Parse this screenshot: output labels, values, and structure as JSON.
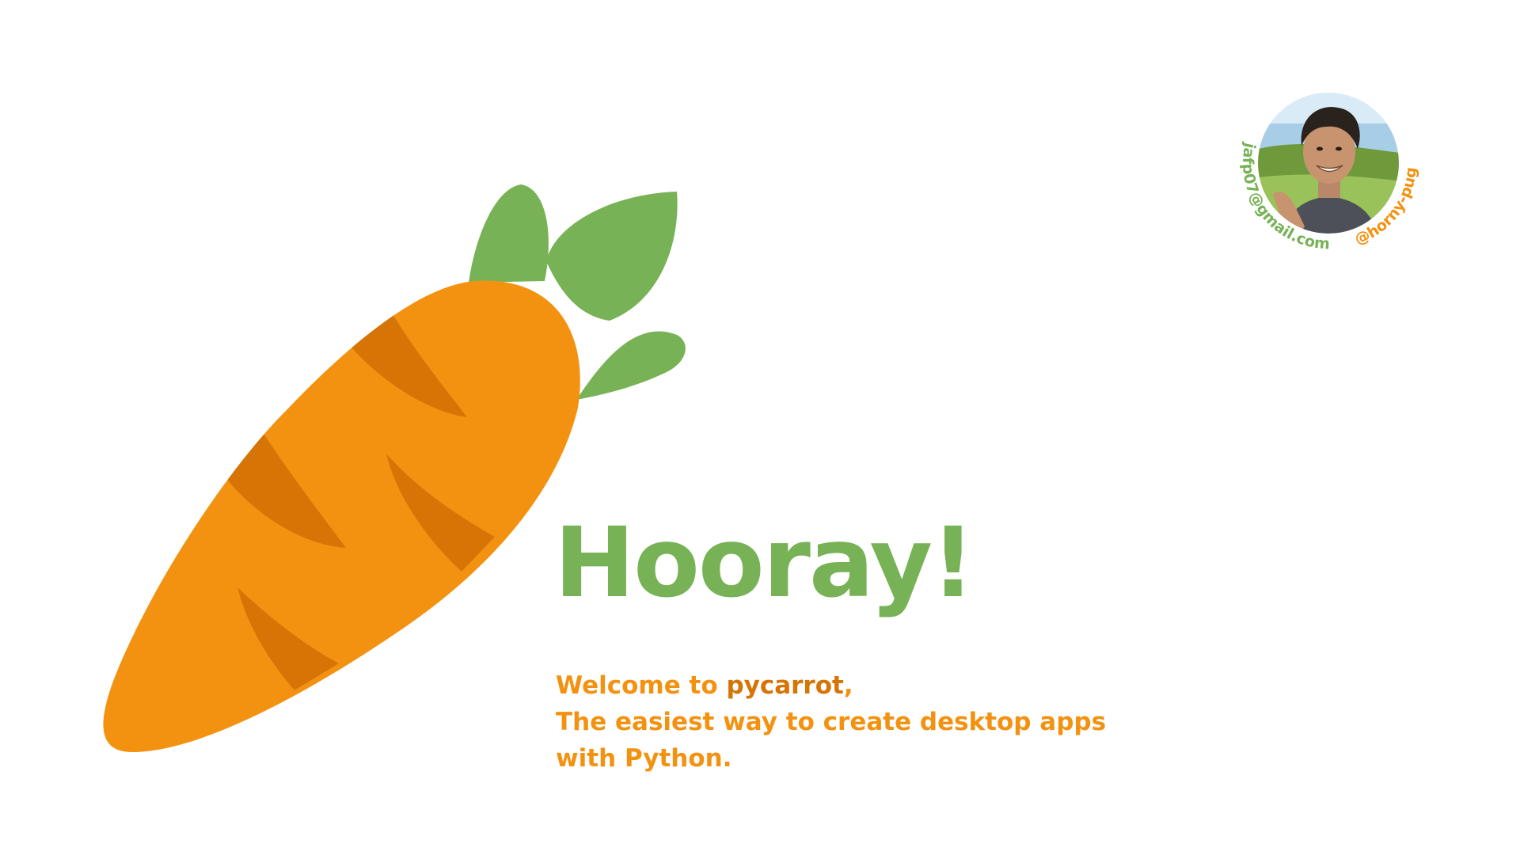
{
  "hero": {
    "title": "Hooray!"
  },
  "welcome": {
    "prefix": "Welcome to ",
    "brand": "pycarrot",
    "suffix": ",",
    "line2": "The easiest way to create desktop apps",
    "line3": "with Python."
  },
  "author": {
    "email": "jafp07@gmail.com",
    "handle": "@horny-pug"
  },
  "colors": {
    "carrot_orange": "#f39211",
    "carrot_stripe": "#d67406",
    "leaf_green": "#78b256",
    "text_orange": "#f39211",
    "brand_orange": "#d67406",
    "title_green": "#78b256",
    "background": "#ffffff"
  },
  "icons": {
    "carrot": "carrot-icon",
    "avatar": "avatar-photo"
  }
}
